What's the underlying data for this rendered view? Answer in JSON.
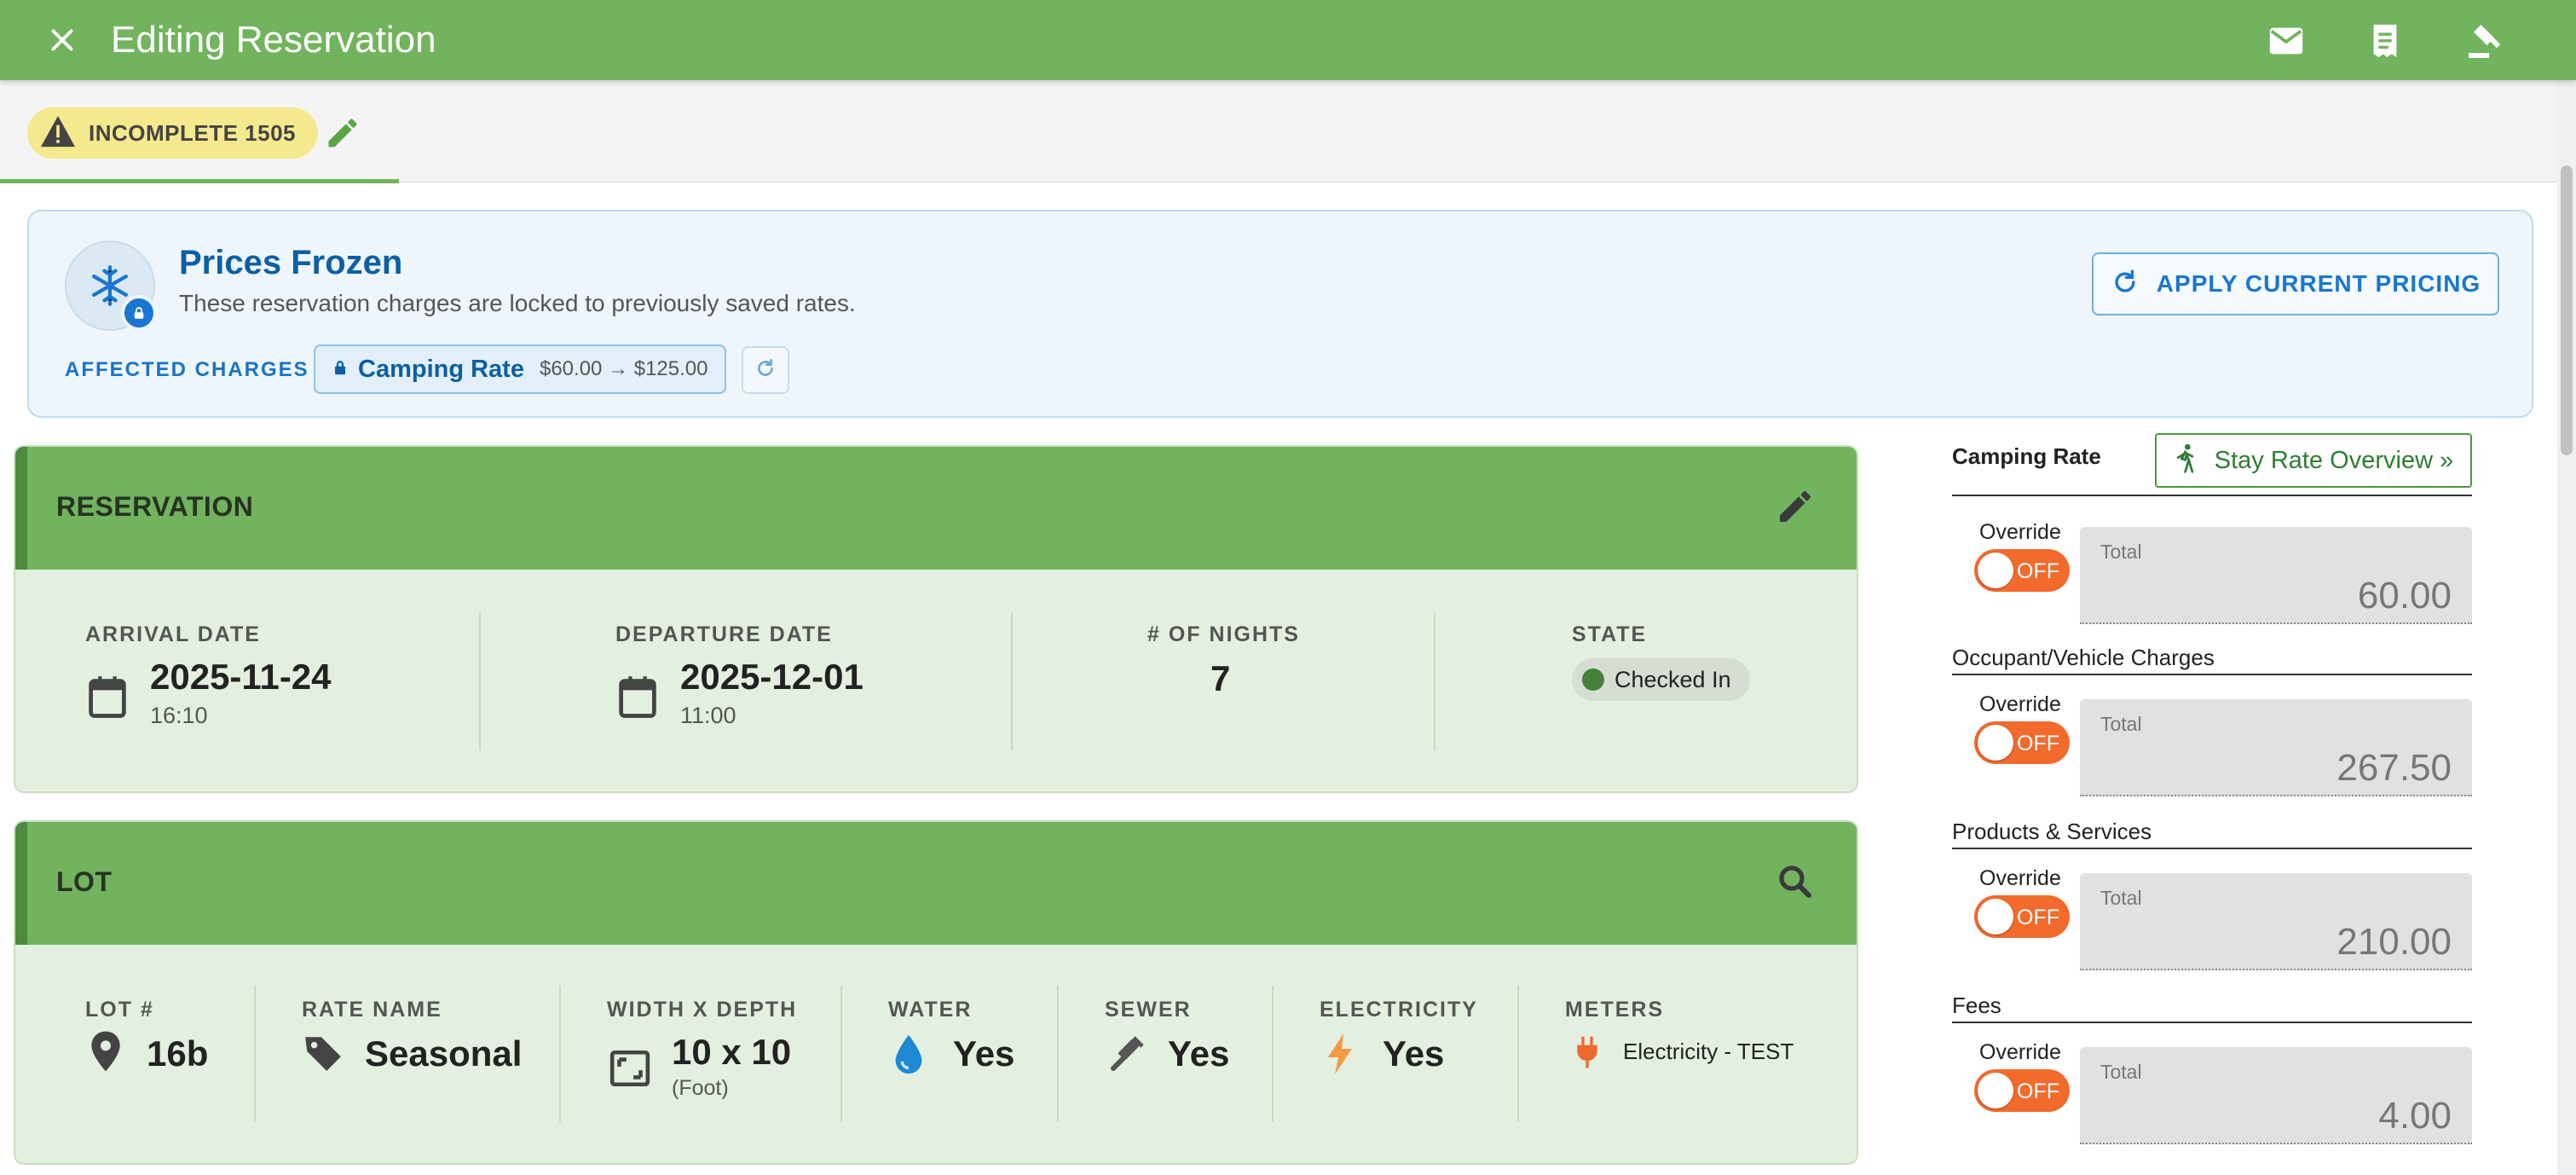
{
  "app_bar": {
    "title": "Editing Reservation",
    "icons": [
      "close-icon",
      "email-icon",
      "receipt-icon",
      "gavel-icon"
    ]
  },
  "status": {
    "label": "INCOMPLETE 1505",
    "color": "#f4e98c",
    "icon": "warning-icon"
  },
  "frozen": {
    "title": "Prices Frozen",
    "subtitle": "These reservation charges are locked to previously saved rates.",
    "affected_label": "AFFECTED CHARGES",
    "charge_name": "Camping Rate",
    "charge_range": "$60.00 → $125.00",
    "apply_label": "APPLY CURRENT PRICING",
    "accent": "#1976d2"
  },
  "reservation": {
    "title": "RESERVATION",
    "arrival_label": "ARRIVAL DATE",
    "arrival_date": "2025-11-24",
    "arrival_time": "16:10",
    "departure_label": "DEPARTURE DATE",
    "departure_date": "2025-12-01",
    "departure_time": "11:00",
    "nights_label": "# OF NIGHTS",
    "nights": "7",
    "state_label": "STATE",
    "state": "Checked In"
  },
  "lot": {
    "title": "LOT",
    "lot_label": "LOT #",
    "lot": "16b",
    "rate_label": "RATE NAME",
    "rate": "Seasonal",
    "size_label": "WIDTH X DEPTH",
    "size": "10 x 10",
    "size_unit": "(Foot)",
    "water_label": "WATER",
    "water": "Yes",
    "sewer_label": "SEWER",
    "sewer": "Yes",
    "electricity_label": "ELECTRICITY",
    "electricity": "Yes",
    "meters_label": "METERS",
    "meters": "Electricity - TEST"
  },
  "pricing": {
    "stay_button": "Stay Rate Overview »",
    "override_label": "Override",
    "toggle_label": "OFF",
    "total_caption": "Total",
    "sections": [
      {
        "title": "Camping Rate",
        "total": "60.00"
      },
      {
        "title": "Occupant/Vehicle Charges",
        "total": "267.50"
      },
      {
        "title": "Products & Services",
        "total": "210.00"
      },
      {
        "title": "Fees",
        "total": "4.00"
      }
    ]
  },
  "colors": {
    "header_green": "#72b35e",
    "card_bg": "#e3f0df",
    "toggle_off": "#f26a2c"
  }
}
